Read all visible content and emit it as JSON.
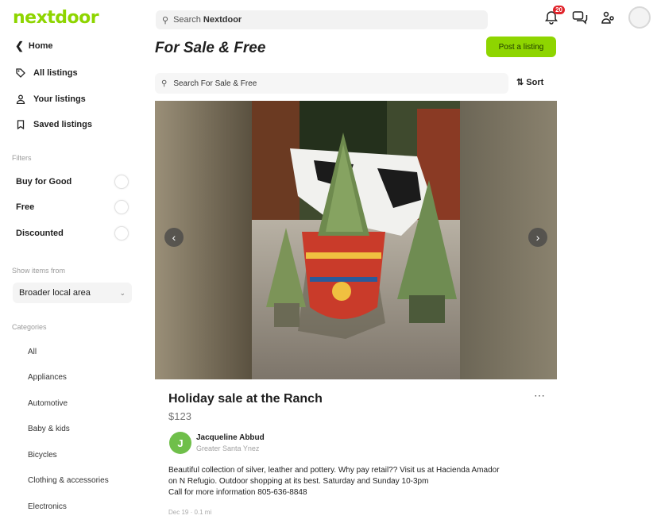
{
  "app": {
    "logo": "nextdoor"
  },
  "header": {
    "search_prefix": "Search",
    "search_brand": "Nextdoor",
    "notifications_count": "20"
  },
  "sidebar": {
    "home": "Home",
    "nav": [
      {
        "label": "All listings",
        "icon": "tag-icon"
      },
      {
        "label": "Your listings",
        "icon": "person-icon"
      },
      {
        "label": "Saved listings",
        "icon": "bookmark-icon"
      }
    ],
    "filters_label": "Filters",
    "filters": [
      {
        "label": "Buy for Good",
        "on": false
      },
      {
        "label": "Free",
        "on": false
      },
      {
        "label": "Discounted",
        "on": false
      }
    ],
    "show_items_label": "Show items from",
    "area_select": "Broader local area",
    "categories_label": "Categories",
    "categories": [
      "All",
      "Appliances",
      "Automotive",
      "Baby & kids",
      "Bicycles",
      "Clothing & accessories",
      "Electronics"
    ]
  },
  "main": {
    "title": "For Sale & Free",
    "post_button": "Post a listing",
    "search_placeholder": "Search For Sale & Free",
    "sort_label": "Sort"
  },
  "listing": {
    "title": "Holiday sale at the Ranch",
    "price": "$123",
    "seller_initial": "J",
    "seller_name": "Jacqueline Abbud",
    "seller_location": "Greater Santa Ynez",
    "description_lines": [
      "Beautiful collection of silver, leather and pottery. Why pay retail?? Visit us at Hacienda Amador",
      "on N Refugio. Outdoor shopping at its best. Saturday and Sunday 10-3pm",
      "Call for more information 805-636-8848"
    ],
    "meta": "Dec 19 · 0.1 mi"
  },
  "colors": {
    "brand": "#8ed500",
    "badge": "#e0242b",
    "avatar": "#6fbf4a"
  }
}
